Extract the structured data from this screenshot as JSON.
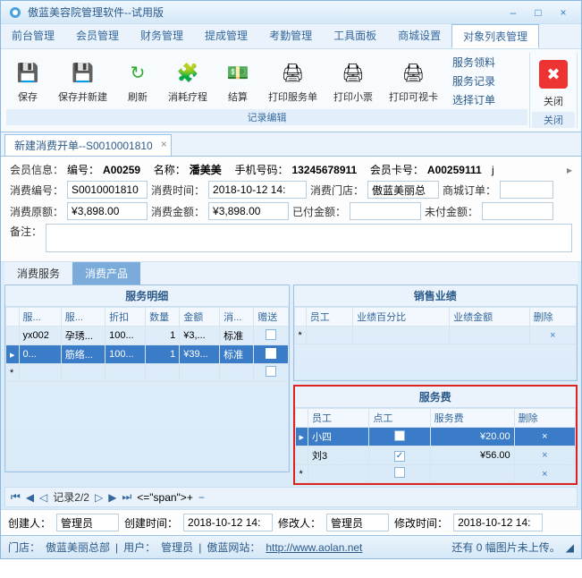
{
  "window": {
    "title": "傲蓝美容院管理软件--试用版"
  },
  "menu": {
    "items": [
      "前台管理",
      "会员管理",
      "财务管理",
      "提成管理",
      "考勤管理",
      "工具面板",
      "商城设置",
      "对象列表管理"
    ],
    "active": 7
  },
  "ribbon": {
    "save": "保存",
    "save_new": "保存并新建",
    "refresh": "刷新",
    "consume_course": "消耗疗程",
    "settle": "结算",
    "print_service": "打印服务单",
    "print_ticket": "打印小票",
    "print_card": "打印可视卡",
    "link1": "服务领料",
    "link2": "服务记录",
    "link3": "选择订单",
    "close": "关闭",
    "group1": "记录编辑",
    "group2": "关闭"
  },
  "doctab": {
    "title": "新建消费开单--S0010001810"
  },
  "member": {
    "info_label": "会员信息：",
    "id_label": "编号：",
    "id": "A00259",
    "name_label": "名称：",
    "name": "潘美美",
    "mobile_label": "手机号码：",
    "mobile": "13245678911",
    "cardno_label": "会员卡号：",
    "cardno": "A00259111",
    "j": "j"
  },
  "order": {
    "no_label": "消费编号：",
    "no": "S0010001810",
    "time_label": "消费时间：",
    "time": "2018-10-12 14:",
    "store_label": "消费门店：",
    "store": "傲蓝美丽总",
    "mall_label": "商城订单：",
    "mall": "",
    "orig_label": "消费原额：",
    "orig": "¥3,898.00",
    "amount_label": "消费金额：",
    "amount": "¥3,898.00",
    "paid_label": "已付金额：",
    "paid": "",
    "unpaid_label": "未付金额：",
    "unpaid": "",
    "remark_label": "备注："
  },
  "subtabs": {
    "a": "消费服务",
    "b": "消费产品"
  },
  "service_grid": {
    "title": "服务明细",
    "cols": [
      "服...",
      "服...",
      "折扣",
      "数量",
      "金额",
      "消...",
      "赠送"
    ],
    "row0": {
      "c0": "yx002",
      "c1": "孕琇...",
      "c2": "100...",
      "c3": "1",
      "c4": "¥3,...",
      "c5": "标准"
    },
    "row1": {
      "c0": "0...",
      "c1": "筋络...",
      "c2": "100...",
      "c3": "1",
      "c4": "¥39...",
      "c5": "标准"
    }
  },
  "sales_grid": {
    "title": "销售业绩",
    "cols": [
      "员工",
      "业绩百分比",
      "业绩金额",
      "删除"
    ]
  },
  "fee_grid": {
    "title": "服务费",
    "cols": [
      "员工",
      "点工",
      "服务费",
      "删除"
    ],
    "row0": {
      "emp": "小四",
      "checked": false,
      "fee": "¥20.00"
    },
    "row1": {
      "emp": "刘3",
      "checked": true,
      "fee": "¥56.00"
    }
  },
  "nav": {
    "record": "记录2/2"
  },
  "footer": {
    "creator_label": "创建人：",
    "creator": "管理员",
    "ctime_label": "创建时间：",
    "ctime": "2018-10-12 14:",
    "modifier_label": "修改人：",
    "modifier": "管理员",
    "mtime_label": "修改时间：",
    "mtime": "2018-10-12 14:"
  },
  "status": {
    "store_label": "门店：",
    "store": "傲蓝美丽总部",
    "user_label": "用户：",
    "user": "管理员",
    "site_label": "傲蓝网站：",
    "site_url": "http://www.aolan.net",
    "right": "还有 0 幅图片未上传。"
  }
}
